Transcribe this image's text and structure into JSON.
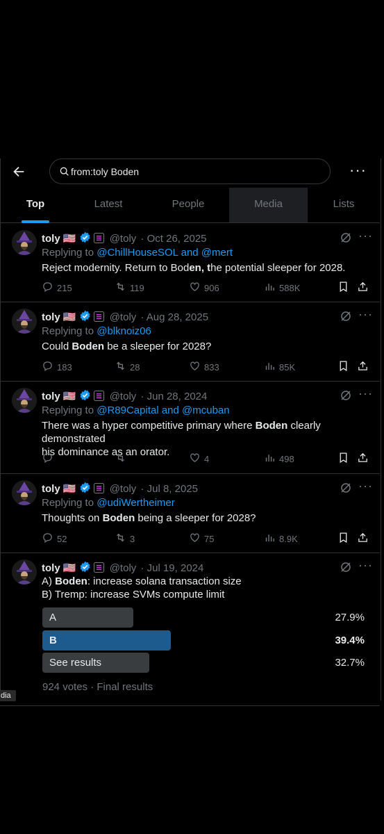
{
  "search": {
    "query": "from:toly Boden"
  },
  "tabs": [
    {
      "label": "Top"
    },
    {
      "label": "Latest"
    },
    {
      "label": "People"
    },
    {
      "label": "Media"
    },
    {
      "label": "Lists"
    }
  ],
  "tweets": [
    {
      "name": "toly",
      "flag": "🇺🇸",
      "handle": "@toly",
      "date": "· Oct 26, 2025",
      "reply_prefix": "Replying to ",
      "reply_to": "@ChillHouseSOL and @mert",
      "text_parts": [
        "Reject modernity.  Return to Bod",
        "en, t",
        "he potential sleeper for 2028."
      ],
      "replies": "215",
      "reposts": "119",
      "likes": "906",
      "views": "588K"
    },
    {
      "name": "toly",
      "flag": "🇺🇸",
      "handle": "@toly",
      "date": "· Aug 28, 2025",
      "reply_prefix": "Replying to ",
      "reply_to": "@blknoiz06",
      "text_parts": [
        "Could ",
        "Boden",
        " be a sleeper for 2028?"
      ],
      "replies": "183",
      "reposts": "28",
      "likes": "833",
      "views": "85K"
    },
    {
      "name": "toly",
      "flag": "🇺🇸",
      "handle": "@toly",
      "date": "· Jun 28, 2024",
      "reply_prefix": "Replying to ",
      "reply_to": "@R89Capital and @mcuban",
      "text_parts": [
        "There was a hyper competitive primary where ",
        "Boden",
        " clearly demonstrated",
        "his dominance as an orator."
      ],
      "replies": "",
      "reposts": "",
      "likes": "4",
      "views": "498"
    },
    {
      "name": "toly",
      "flag": "🇺🇸",
      "handle": "@toly",
      "date": "· Jul 8, 2025",
      "reply_prefix": "Replying to ",
      "reply_to": "@udiWertheimer",
      "text_parts": [
        "Thoughts on ",
        "Boden",
        " being a sleeper for 2028?"
      ],
      "replies": "52",
      "reposts": "3",
      "likes": "75",
      "views": "8.9K"
    },
    {
      "name": "toly",
      "flag": "🇺🇸",
      "handle": "@toly",
      "date": "· Jul 19, 2024",
      "text_parts": [
        "A) ",
        "Boden",
        ": increase solana transaction size",
        "B) Tremp: increase SVMs compute limit"
      ],
      "poll": {
        "options": [
          {
            "label": "A",
            "percent": "27.9%",
            "value": 0.279
          },
          {
            "label": "B",
            "percent": "39.4%",
            "value": 0.394
          },
          {
            "label": "See results",
            "percent": "32.7%",
            "value": 0.327
          }
        ],
        "footer": "924 votes · Final results"
      }
    }
  ],
  "overlay": {
    "label": "dia"
  },
  "colors": {
    "accent": "#1d9bf0",
    "poll_winner": "#1d5b8f",
    "poll_other": "#3a3d40",
    "muted": "#71767b",
    "verified": "#1d9bf0"
  }
}
